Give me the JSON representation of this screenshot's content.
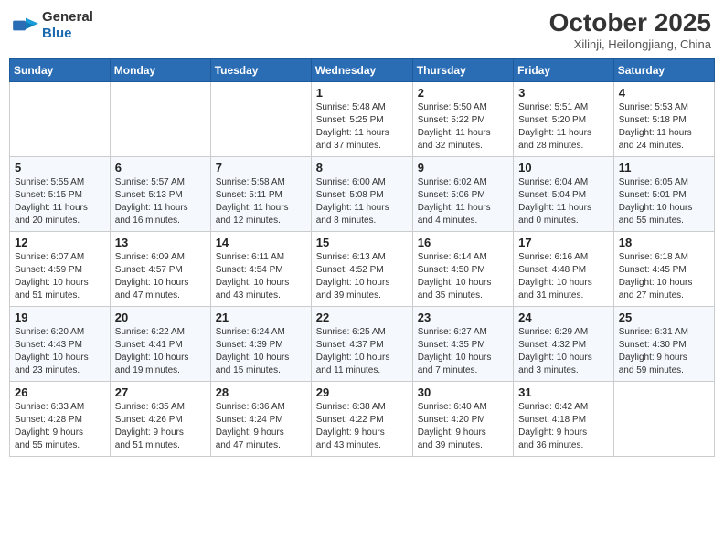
{
  "header": {
    "logo_general": "General",
    "logo_blue": "Blue",
    "month_title": "October 2025",
    "subtitle": "Xilinji, Heilongjiang, China"
  },
  "weekdays": [
    "Sunday",
    "Monday",
    "Tuesday",
    "Wednesday",
    "Thursday",
    "Friday",
    "Saturday"
  ],
  "rows": [
    [
      {
        "day": "",
        "info": ""
      },
      {
        "day": "",
        "info": ""
      },
      {
        "day": "",
        "info": ""
      },
      {
        "day": "1",
        "info": "Sunrise: 5:48 AM\nSunset: 5:25 PM\nDaylight: 11 hours\nand 37 minutes."
      },
      {
        "day": "2",
        "info": "Sunrise: 5:50 AM\nSunset: 5:22 PM\nDaylight: 11 hours\nand 32 minutes."
      },
      {
        "day": "3",
        "info": "Sunrise: 5:51 AM\nSunset: 5:20 PM\nDaylight: 11 hours\nand 28 minutes."
      },
      {
        "day": "4",
        "info": "Sunrise: 5:53 AM\nSunset: 5:18 PM\nDaylight: 11 hours\nand 24 minutes."
      }
    ],
    [
      {
        "day": "5",
        "info": "Sunrise: 5:55 AM\nSunset: 5:15 PM\nDaylight: 11 hours\nand 20 minutes."
      },
      {
        "day": "6",
        "info": "Sunrise: 5:57 AM\nSunset: 5:13 PM\nDaylight: 11 hours\nand 16 minutes."
      },
      {
        "day": "7",
        "info": "Sunrise: 5:58 AM\nSunset: 5:11 PM\nDaylight: 11 hours\nand 12 minutes."
      },
      {
        "day": "8",
        "info": "Sunrise: 6:00 AM\nSunset: 5:08 PM\nDaylight: 11 hours\nand 8 minutes."
      },
      {
        "day": "9",
        "info": "Sunrise: 6:02 AM\nSunset: 5:06 PM\nDaylight: 11 hours\nand 4 minutes."
      },
      {
        "day": "10",
        "info": "Sunrise: 6:04 AM\nSunset: 5:04 PM\nDaylight: 11 hours\nand 0 minutes."
      },
      {
        "day": "11",
        "info": "Sunrise: 6:05 AM\nSunset: 5:01 PM\nDaylight: 10 hours\nand 55 minutes."
      }
    ],
    [
      {
        "day": "12",
        "info": "Sunrise: 6:07 AM\nSunset: 4:59 PM\nDaylight: 10 hours\nand 51 minutes."
      },
      {
        "day": "13",
        "info": "Sunrise: 6:09 AM\nSunset: 4:57 PM\nDaylight: 10 hours\nand 47 minutes."
      },
      {
        "day": "14",
        "info": "Sunrise: 6:11 AM\nSunset: 4:54 PM\nDaylight: 10 hours\nand 43 minutes."
      },
      {
        "day": "15",
        "info": "Sunrise: 6:13 AM\nSunset: 4:52 PM\nDaylight: 10 hours\nand 39 minutes."
      },
      {
        "day": "16",
        "info": "Sunrise: 6:14 AM\nSunset: 4:50 PM\nDaylight: 10 hours\nand 35 minutes."
      },
      {
        "day": "17",
        "info": "Sunrise: 6:16 AM\nSunset: 4:48 PM\nDaylight: 10 hours\nand 31 minutes."
      },
      {
        "day": "18",
        "info": "Sunrise: 6:18 AM\nSunset: 4:45 PM\nDaylight: 10 hours\nand 27 minutes."
      }
    ],
    [
      {
        "day": "19",
        "info": "Sunrise: 6:20 AM\nSunset: 4:43 PM\nDaylight: 10 hours\nand 23 minutes."
      },
      {
        "day": "20",
        "info": "Sunrise: 6:22 AM\nSunset: 4:41 PM\nDaylight: 10 hours\nand 19 minutes."
      },
      {
        "day": "21",
        "info": "Sunrise: 6:24 AM\nSunset: 4:39 PM\nDaylight: 10 hours\nand 15 minutes."
      },
      {
        "day": "22",
        "info": "Sunrise: 6:25 AM\nSunset: 4:37 PM\nDaylight: 10 hours\nand 11 minutes."
      },
      {
        "day": "23",
        "info": "Sunrise: 6:27 AM\nSunset: 4:35 PM\nDaylight: 10 hours\nand 7 minutes."
      },
      {
        "day": "24",
        "info": "Sunrise: 6:29 AM\nSunset: 4:32 PM\nDaylight: 10 hours\nand 3 minutes."
      },
      {
        "day": "25",
        "info": "Sunrise: 6:31 AM\nSunset: 4:30 PM\nDaylight: 9 hours\nand 59 minutes."
      }
    ],
    [
      {
        "day": "26",
        "info": "Sunrise: 6:33 AM\nSunset: 4:28 PM\nDaylight: 9 hours\nand 55 minutes."
      },
      {
        "day": "27",
        "info": "Sunrise: 6:35 AM\nSunset: 4:26 PM\nDaylight: 9 hours\nand 51 minutes."
      },
      {
        "day": "28",
        "info": "Sunrise: 6:36 AM\nSunset: 4:24 PM\nDaylight: 9 hours\nand 47 minutes."
      },
      {
        "day": "29",
        "info": "Sunrise: 6:38 AM\nSunset: 4:22 PM\nDaylight: 9 hours\nand 43 minutes."
      },
      {
        "day": "30",
        "info": "Sunrise: 6:40 AM\nSunset: 4:20 PM\nDaylight: 9 hours\nand 39 minutes."
      },
      {
        "day": "31",
        "info": "Sunrise: 6:42 AM\nSunset: 4:18 PM\nDaylight: 9 hours\nand 36 minutes."
      },
      {
        "day": "",
        "info": ""
      }
    ]
  ]
}
